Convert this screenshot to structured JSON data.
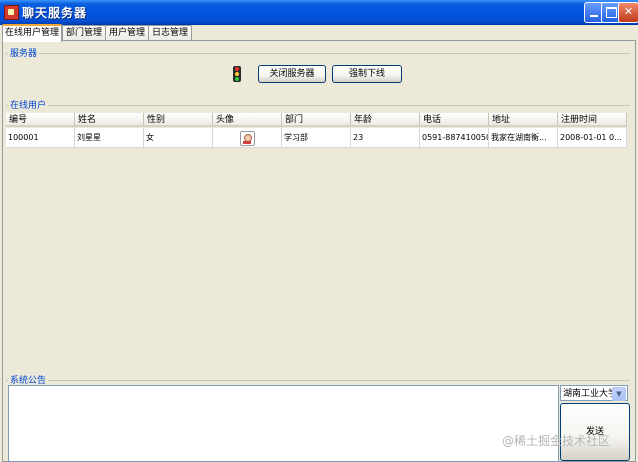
{
  "window": {
    "title": "聊天服务器",
    "min_label": "",
    "max_label": "",
    "close_label": "✕"
  },
  "tabs": [
    {
      "label": "在线用户管理",
      "active": true
    },
    {
      "label": "部门管理",
      "active": false
    },
    {
      "label": "用户管理",
      "active": false
    },
    {
      "label": "日志管理",
      "active": false
    }
  ],
  "server_group": {
    "title": "服务器",
    "close_server_label": "关闭服务器",
    "force_offline_label": "强制下线",
    "icon": "traffic-light-icon"
  },
  "online_group": {
    "title": "在线用户",
    "columns": [
      "编号",
      "姓名",
      "性别",
      "头像",
      "部门",
      "年龄",
      "电话",
      "地址",
      "注册时间"
    ],
    "rows": [
      {
        "id": "100001",
        "name": "刘星星",
        "gender": "女",
        "avatar": "avatar-icon",
        "dept": "学习部",
        "age": "23",
        "phone": "0591-887410050",
        "address": "我家在湖南衡...",
        "reg_time": "2008-01-01 0..."
      }
    ]
  },
  "announce_group": {
    "title": "系统公告",
    "recipient_value": "湖南工业大学",
    "send_label": "发送",
    "text": ""
  },
  "watermark": "@稀土掘金技术社区",
  "colors": {
    "titlebar": "#0053E1",
    "group_title": "#0046D5",
    "panel_bg": "#ECE9D8"
  }
}
